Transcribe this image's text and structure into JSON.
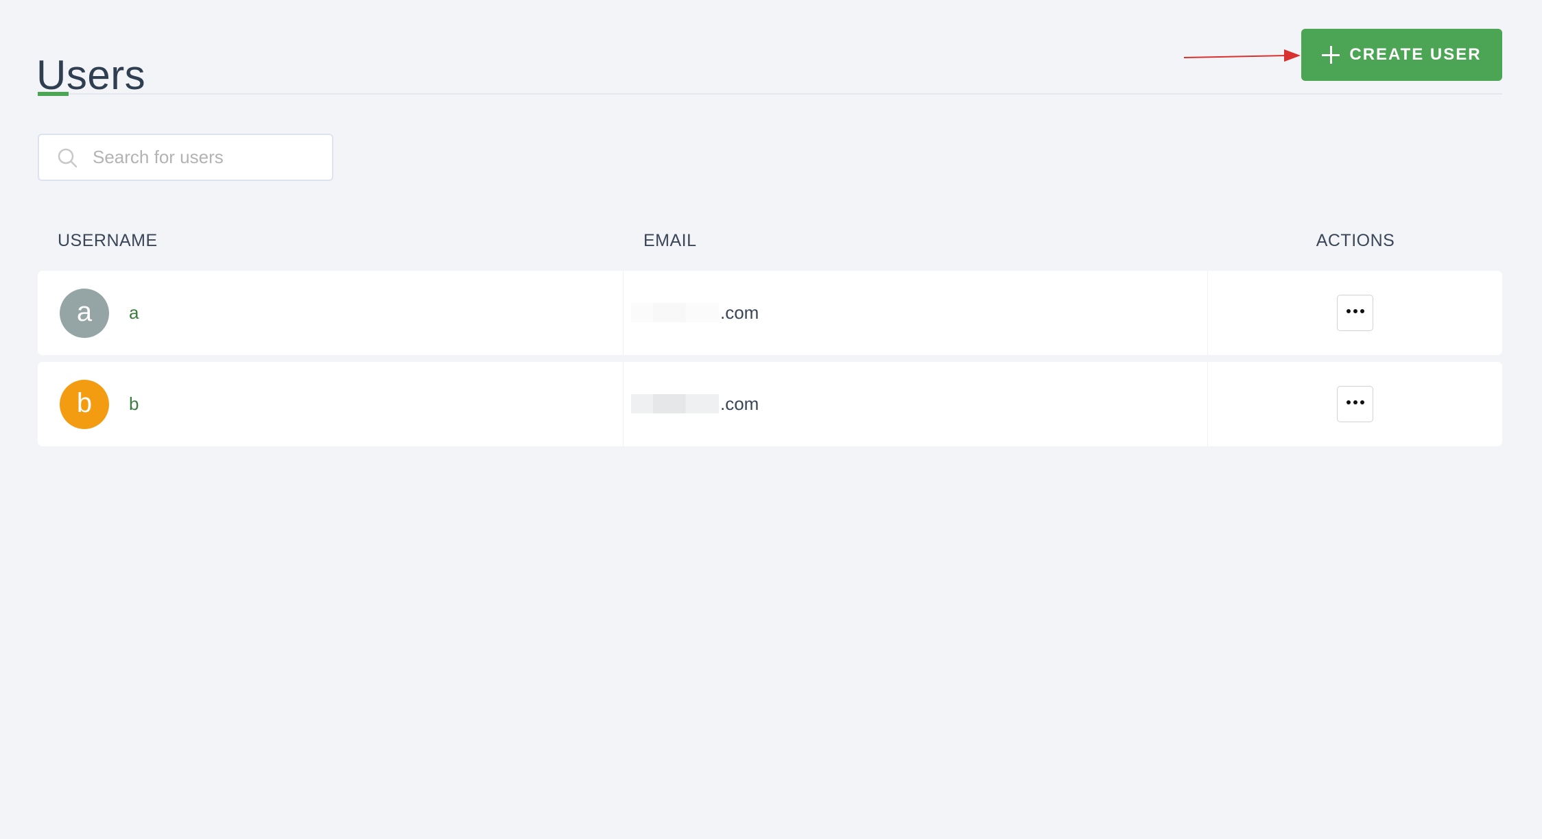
{
  "page": {
    "title": "Users",
    "accent_color": "#4ca455"
  },
  "toolbar": {
    "create_user_label": "CREATE USER",
    "create_user_icon": "plus-icon",
    "annotation": "red-arrow-pointing-to-create-user"
  },
  "search": {
    "placeholder": "Search for users",
    "value": "",
    "icon": "search-icon"
  },
  "table": {
    "columns": [
      {
        "key": "username",
        "label": "USERNAME"
      },
      {
        "key": "email",
        "label": "EMAIL"
      },
      {
        "key": "actions",
        "label": "ACTIONS"
      }
    ],
    "rows": [
      {
        "avatar_letter": "a",
        "avatar_color": "#95a5a6",
        "username": "a",
        "email_visible": ".com",
        "email_redacted": true,
        "actions_icon": "more-horizontal-icon"
      },
      {
        "avatar_letter": "b",
        "avatar_color": "#f39c12",
        "username": "b",
        "email_visible": ".com",
        "email_redacted": true,
        "actions_icon": "more-horizontal-icon"
      }
    ]
  }
}
